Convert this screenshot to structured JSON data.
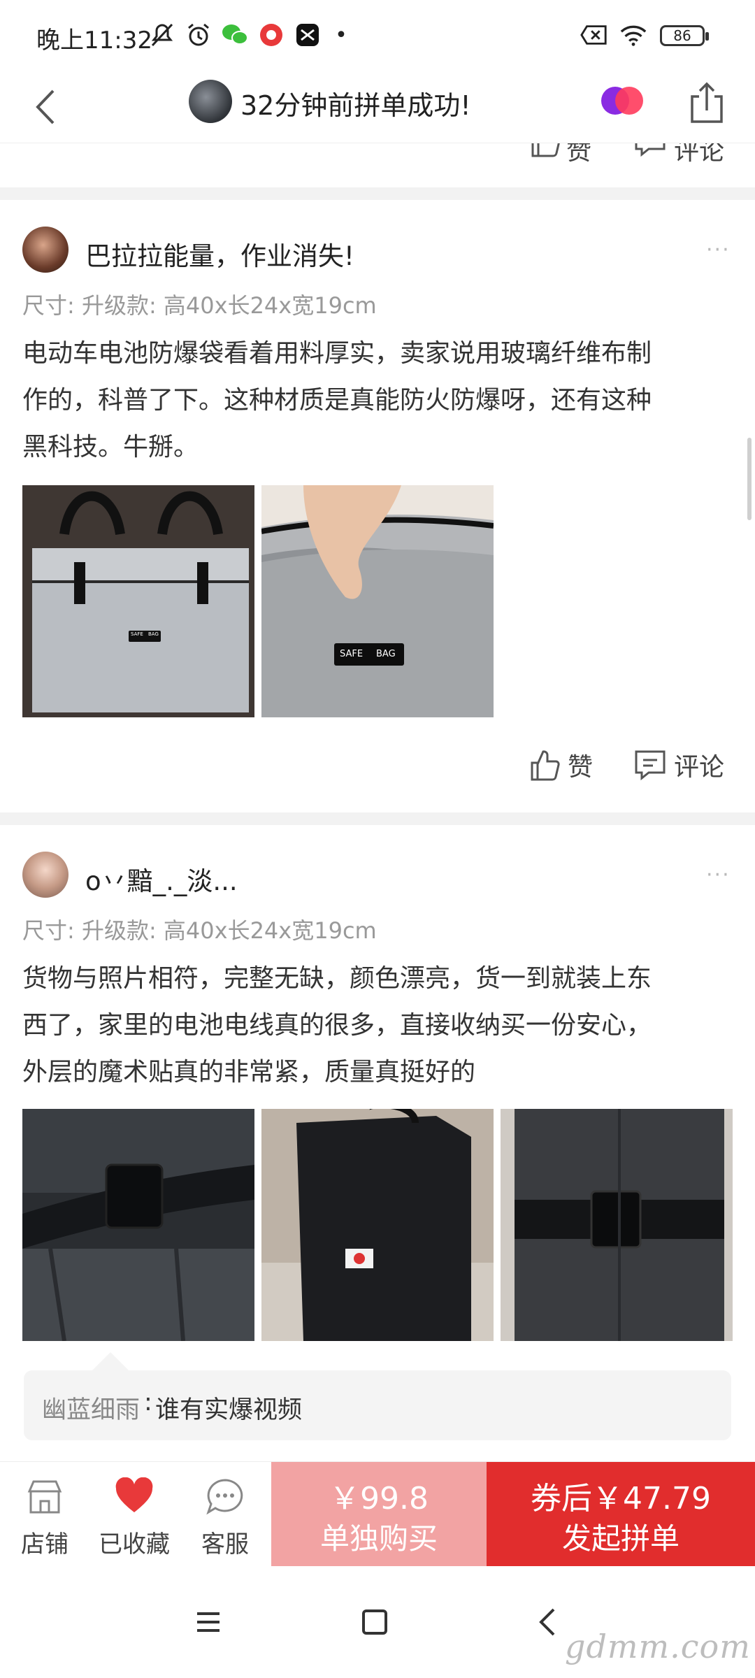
{
  "status_bar": {
    "time": "晚上11:32",
    "battery": "86"
  },
  "nav": {
    "title": "32分钟前拼单成功!"
  },
  "residual": {
    "like": "赞",
    "comment": "评论"
  },
  "reviews": [
    {
      "username": "巴拉拉能量，作业消失!",
      "more": "···",
      "spec": "尺寸: 升级款: 高40x长24x宽19cm",
      "content_lines": [
        "电动车电池防爆袋看着用料厚实，卖家说用玻璃纤维布制",
        "作的，科普了下。这种材质是真能防火防爆呀，还有这种",
        "黑科技。牛掰。"
      ],
      "photo_texts": [
        "SAFE",
        "BAG"
      ],
      "like_label": "赞",
      "comment_label": "评论"
    },
    {
      "username": "ο丷黯_._淡...",
      "more": "···",
      "spec": "尺寸: 升级款: 高40x长24x宽19cm",
      "content_lines": [
        "货物与照片相符，完整无缺，颜色漂亮，货一到就装上东",
        "西了，家里的电池电线真的很多，直接收纳买一份安心，",
        "外层的魔术贴真的非常紧，质量真挺好的"
      ],
      "comment": {
        "name": "幽蓝细雨",
        "text": "谁有实爆视频"
      }
    }
  ],
  "bottom_bar": {
    "store": "店铺",
    "favorited": "已收藏",
    "service": "客服",
    "solo_price": "￥99.8",
    "solo_label": "单独购买",
    "group_price": "券后￥47.79",
    "group_label": "发起拼单"
  },
  "watermark": "gdmm.com",
  "colors": {
    "accent_red": "#e12d2d",
    "light_red": "#f2a3a3",
    "heart": "#e8393a"
  }
}
